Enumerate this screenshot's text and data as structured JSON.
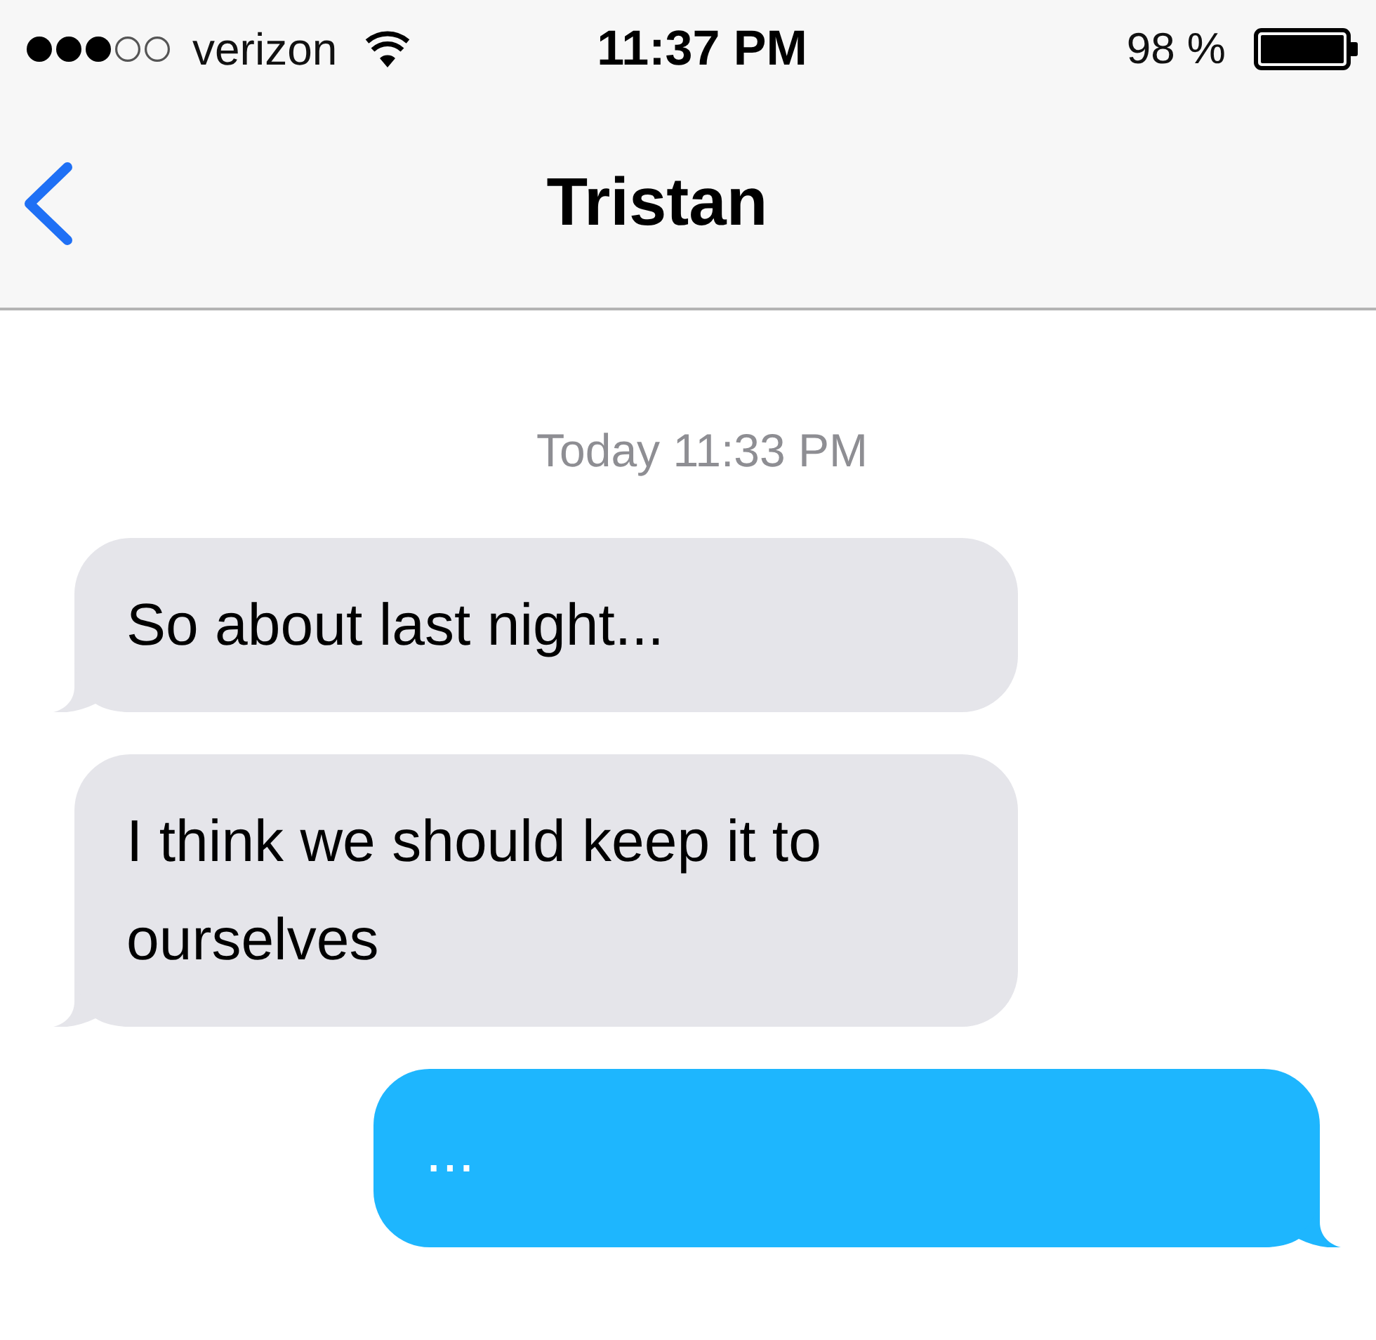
{
  "status_bar": {
    "carrier": "verizon",
    "time": "11:37 PM",
    "battery": "98 %"
  },
  "nav": {
    "title": "Tristan"
  },
  "timestamp": "Today 11:33 PM",
  "messages": [
    {
      "kind": "incoming",
      "text": "So about last night..."
    },
    {
      "kind": "incoming",
      "text": "I think we should keep it to ourselves"
    },
    {
      "kind": "outgoing",
      "text": "..."
    }
  ]
}
